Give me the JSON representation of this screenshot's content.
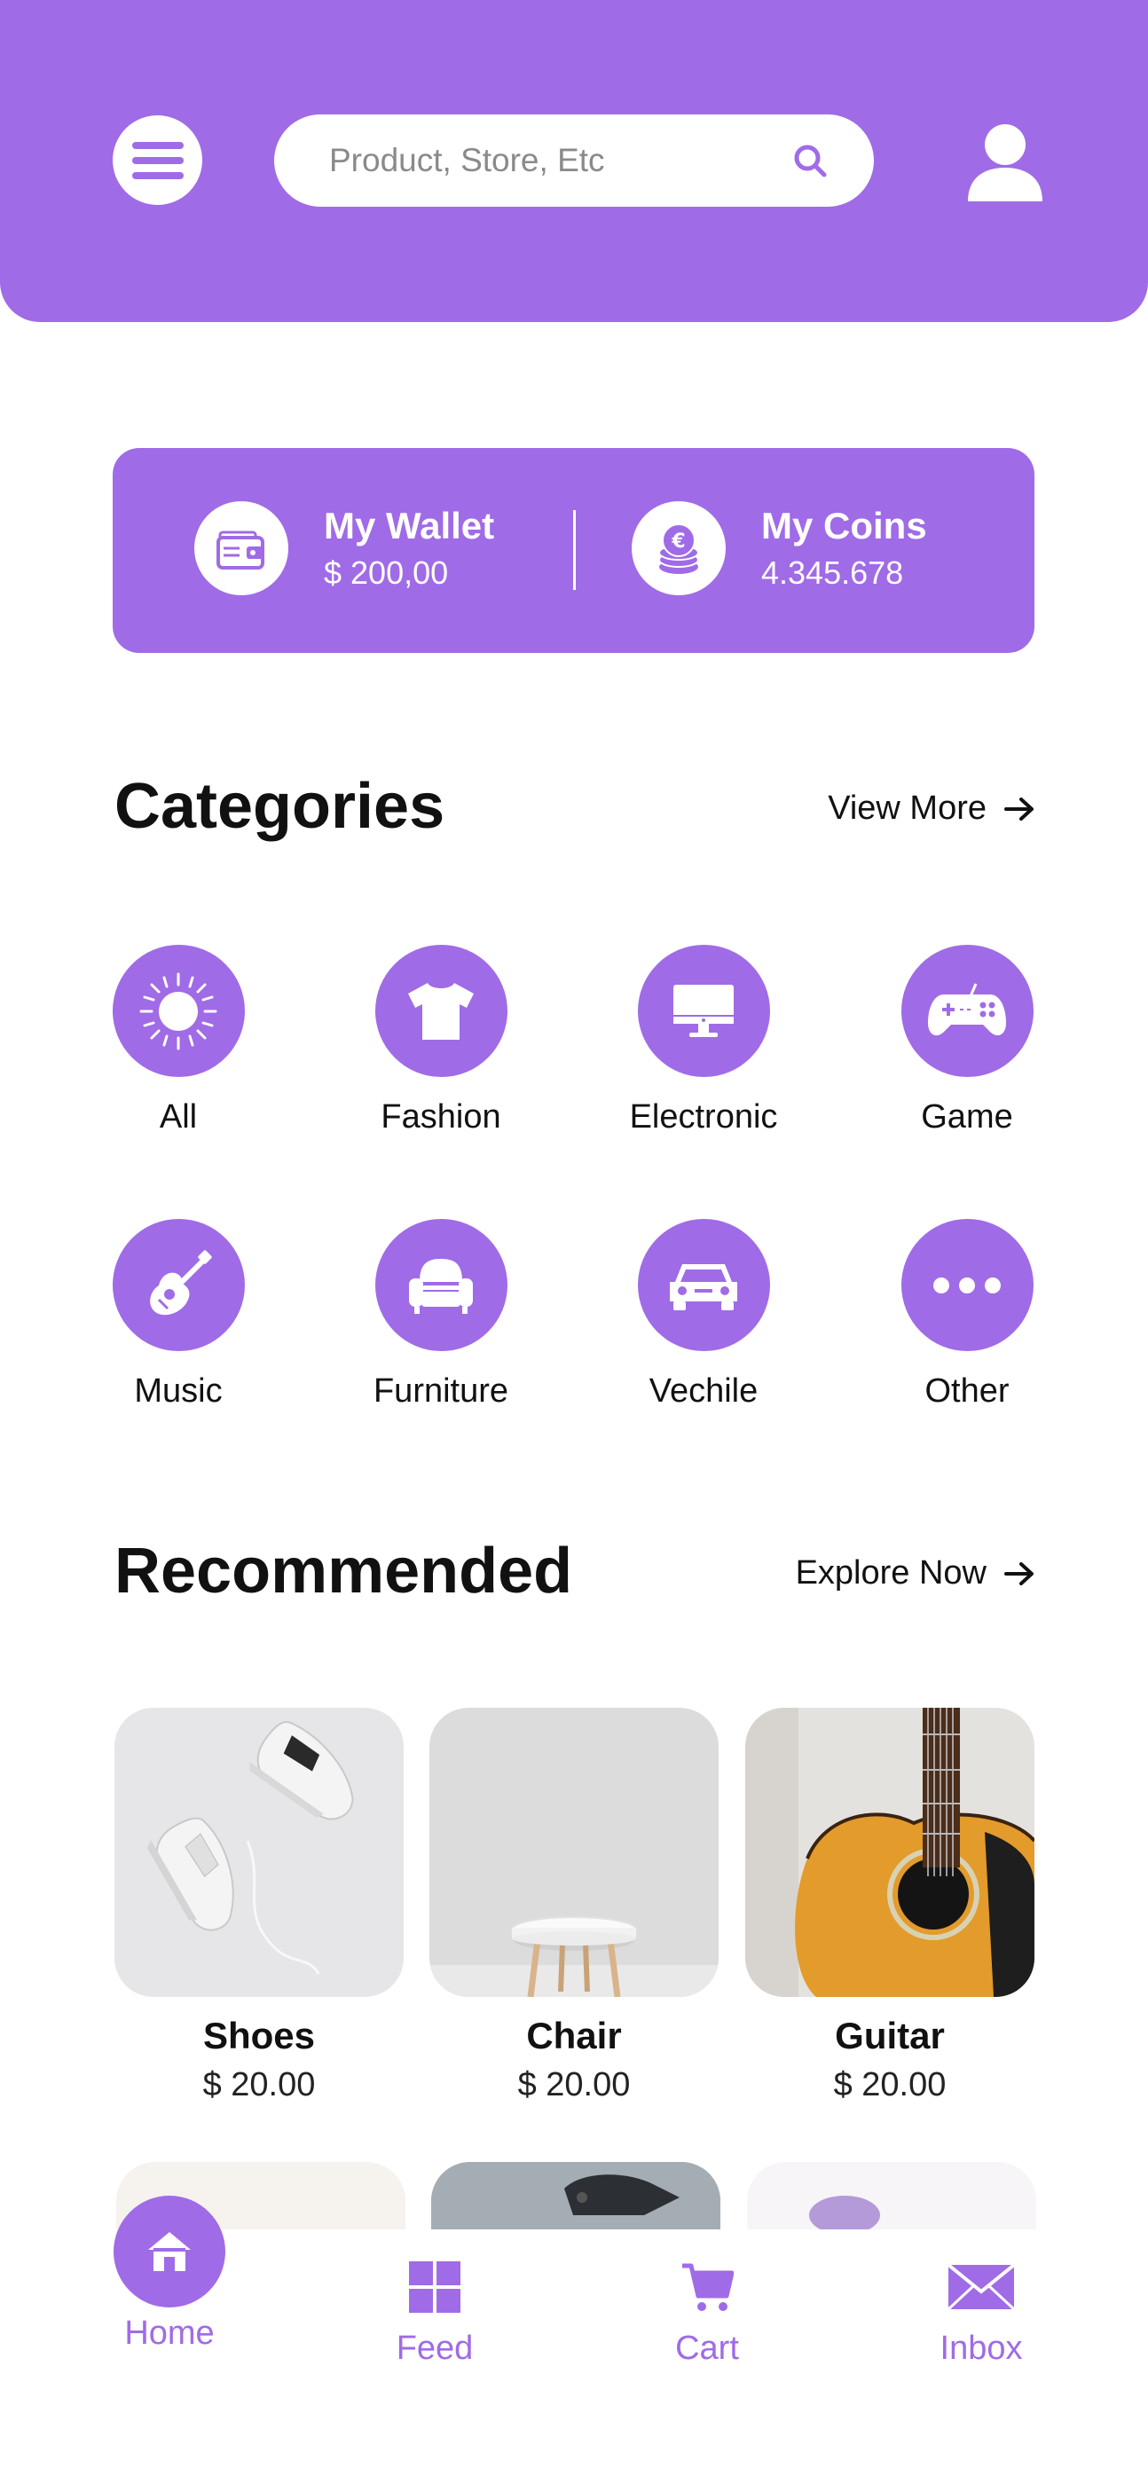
{
  "header": {
    "search_placeholder": "Product, Store, Etc"
  },
  "wallet": {
    "title": "My Wallet",
    "value": "$ 200,00"
  },
  "coins": {
    "title": "My Coins",
    "value": "4.345.678"
  },
  "categories": {
    "title": "Categories",
    "link_label": "View More",
    "items": [
      {
        "label": "All",
        "icon": "sun-icon"
      },
      {
        "label": "Fashion",
        "icon": "tshirt-icon"
      },
      {
        "label": "Electronic",
        "icon": "monitor-icon"
      },
      {
        "label": "Game",
        "icon": "gamepad-icon"
      },
      {
        "label": "Music",
        "icon": "guitar-icon"
      },
      {
        "label": "Furniture",
        "icon": "armchair-icon"
      },
      {
        "label": "Vechile",
        "icon": "car-icon"
      },
      {
        "label": "Other",
        "icon": "more-dots-icon"
      }
    ]
  },
  "recommended": {
    "title": "Recommended",
    "link_label": "Explore Now",
    "items": [
      {
        "name": "Shoes",
        "price": "$ 20.00"
      },
      {
        "name": "Chair",
        "price": "$ 20.00"
      },
      {
        "name": "Guitar",
        "price": "$ 20.00"
      }
    ]
  },
  "bottom_nav": {
    "items": [
      {
        "label": "Home",
        "icon": "home-icon"
      },
      {
        "label": "Feed",
        "icon": "grid-icon"
      },
      {
        "label": "Cart",
        "icon": "cart-icon"
      },
      {
        "label": "Inbox",
        "icon": "envelope-icon"
      }
    ]
  },
  "colors": {
    "accent": "#a06be6",
    "background": "#ffffff",
    "text": "#111111"
  }
}
